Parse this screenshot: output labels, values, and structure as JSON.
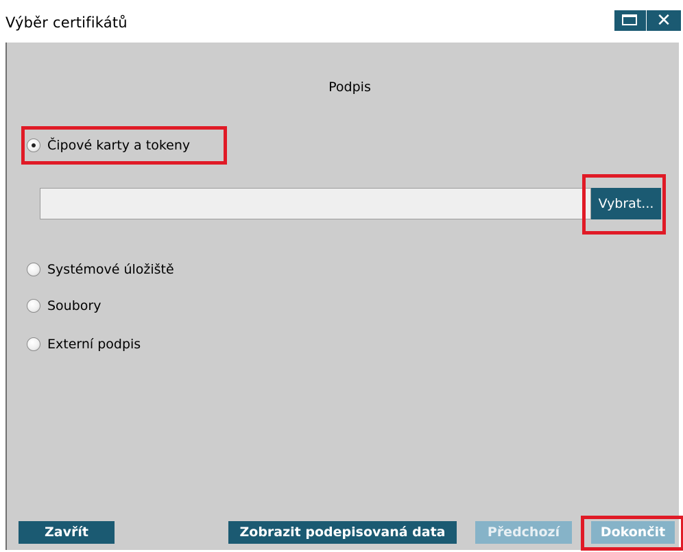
{
  "window": {
    "title": "Výběr certifikátů",
    "maximize_icon": "maximize-icon",
    "close_icon": "close-icon",
    "close_glyph": "✕"
  },
  "section": {
    "heading": "Podpis"
  },
  "options": [
    {
      "label": "Čipové karty a tokeny",
      "checked": true
    },
    {
      "label": "Systémové úložiště",
      "checked": false
    },
    {
      "label": "Soubory",
      "checked": false
    },
    {
      "label": "Externí podpis",
      "checked": false
    }
  ],
  "chip_input": {
    "value": ""
  },
  "choose_button": {
    "label": "Vybrat..."
  },
  "footer": {
    "close_label": "Zavřít",
    "show_data_label": "Zobrazit podepisovaná data",
    "previous_label": "Předchozí",
    "finish_label": "Dokončit"
  },
  "colors": {
    "button_primary": "#1b5a72",
    "button_disabled": "#86b3c8",
    "highlight": "#e01a26",
    "panel_background": "#cdcdcd"
  }
}
